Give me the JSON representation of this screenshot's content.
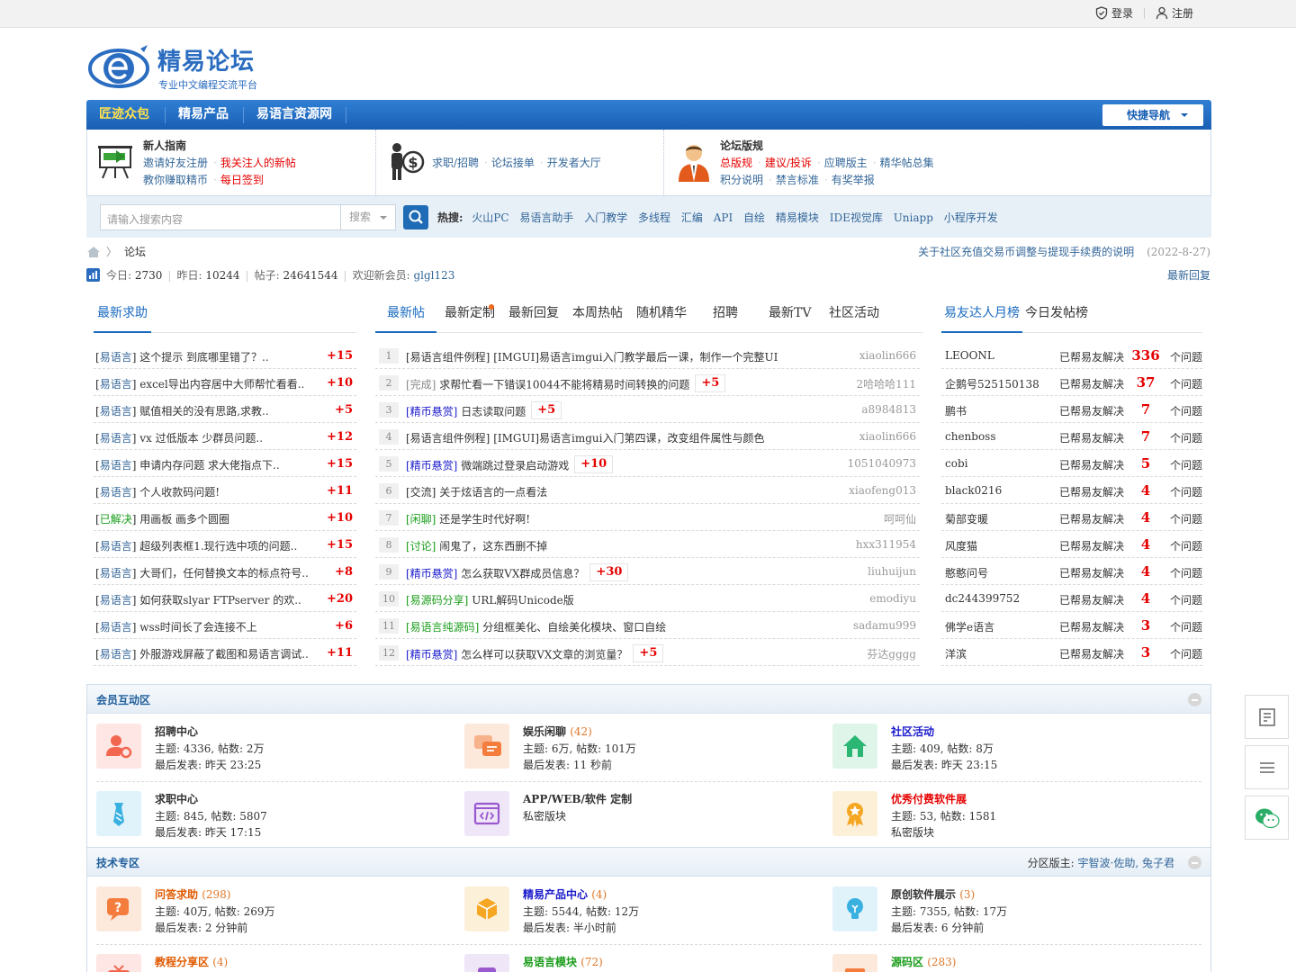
{
  "topbar": {
    "login": "登录",
    "register": "注册"
  },
  "logo": {
    "name": "精易论坛",
    "slogan": "专业中文编程交流平台"
  },
  "nav": {
    "items": [
      "匠迹众包",
      "精易产品",
      "易语言资源网"
    ],
    "quick": "快捷导航"
  },
  "guide": {
    "col1": {
      "title": "新人指南",
      "links1": [
        "邀请好友注册",
        "我关注人的新帖"
      ],
      "links2": [
        "教你赚取精币",
        "每日签到"
      ]
    },
    "col2": {
      "links": [
        "求职/招聘",
        "论坛接单",
        "开发者大厅"
      ]
    },
    "col3": {
      "title": "论坛版规",
      "links1": [
        "总版规",
        "建议/投诉",
        "应聘版主",
        "精华帖总集"
      ],
      "links2": [
        "积分说明",
        "禁言标准",
        "有奖举报"
      ]
    }
  },
  "search": {
    "placeholder": "请输入搜索内容",
    "type": "搜索",
    "hot_label": "热搜:",
    "hot": [
      "火山PC",
      "易语言助手",
      "入门教学",
      "多线程",
      "汇编",
      "API",
      "自绘",
      "精易模块",
      "IDE视觉库",
      "Uniapp",
      "小程序开发"
    ]
  },
  "breadcrumb": {
    "current": "论坛"
  },
  "notice": {
    "text": "关于社区充值交易币调整与提现手续费的说明",
    "date": "(2022-8-27)"
  },
  "stats": {
    "today_label": "今日:",
    "today": "2730",
    "yesterday_label": "昨日:",
    "yesterday": "10244",
    "posts_label": "帖子:",
    "posts": "24641544",
    "welcome_label": "欢迎新会员:",
    "new_member": "glgl123",
    "latest_reply": "最新回复"
  },
  "qa_tab": "最新求助",
  "qa_list": [
    {
      "cat": "易语言",
      "title": "这个提示 到底哪里错了？..",
      "pts": "+15"
    },
    {
      "cat": "易语言",
      "title": "excel导出内容居中大师帮忙看看..",
      "pts": "+10"
    },
    {
      "cat": "易语言",
      "title": "赋值相关的没有思路,求教..",
      "pts": "+5"
    },
    {
      "cat": "易语言",
      "title": "vx 过低版本 少群员问题..",
      "pts": "+12"
    },
    {
      "cat": "易语言",
      "title": "申请内存问题 求大佬指点下..",
      "pts": "+15"
    },
    {
      "cat": "易语言",
      "title": "个人收款码问题!",
      "pts": "+11"
    },
    {
      "cat": "已解决",
      "title": "用画板 画多个圆圈",
      "pts": "+10"
    },
    {
      "cat": "易语言",
      "title": "超级列表框1.现行选中项的问题..",
      "pts": "+15"
    },
    {
      "cat": "易语言",
      "title": "大哥们，任何替换文本的标点符号..",
      "pts": "+8"
    },
    {
      "cat": "易语言",
      "title": "如何获取slyar FTPserver 的欢..",
      "pts": "+20"
    },
    {
      "cat": "易语言",
      "title": "wss时间长了会连接不上",
      "pts": "+6"
    },
    {
      "cat": "易语言",
      "title": "外服游戏屏蔽了截图和易语言调试..",
      "pts": "+11"
    }
  ],
  "post_tabs": [
    "最新帖",
    "最新定制",
    "最新回复",
    "本周热帖",
    "随机精华",
    "招聘",
    "最新TV",
    "社区活动"
  ],
  "posts": [
    {
      "n": "1",
      "tag": "[易语言组件例程]",
      "title": "[IMGUI]易语言imgui入门教学最后一课，制作一个完整UI",
      "bonus": "",
      "user": "xiaolin666"
    },
    {
      "n": "2",
      "tag": "[完成]",
      "title": "求帮忙看一下错误10044不能将精易时间转换的问题",
      "bonus": "+5",
      "user": "2哈哈哈111"
    },
    {
      "n": "3",
      "tag": "[精币悬赏]",
      "title": "日志读取问题",
      "bonus": "+5",
      "user": "a8984813"
    },
    {
      "n": "4",
      "tag": "[易语言组件例程]",
      "title": "[IMGUI]易语言imgui入门第四课，改变组件属性与颜色",
      "bonus": "",
      "user": "xiaolin666"
    },
    {
      "n": "5",
      "tag": "[精币悬赏]",
      "title": "微端跳过登录启动游戏",
      "bonus": "+10",
      "user": "1051040973"
    },
    {
      "n": "6",
      "tag": "[交流]",
      "title": "关于炫语言的一点看法",
      "bonus": "",
      "user": "xiaofeng013"
    },
    {
      "n": "7",
      "tag": "[闲聊]",
      "title": "还是学生时代好啊!",
      "bonus": "",
      "user": "呵呵仙"
    },
    {
      "n": "8",
      "tag": "[讨论]",
      "title": "闹鬼了，这东西删不掉",
      "bonus": "",
      "user": "hxx311954"
    },
    {
      "n": "9",
      "tag": "[精币悬赏]",
      "title": "怎么获取VX群成员信息？",
      "bonus": "+30",
      "user": "liuhuijun"
    },
    {
      "n": "10",
      "tag": "[易源码分享]",
      "title": "URL解码Unicode版",
      "bonus": "",
      "user": "emodiyu"
    },
    {
      "n": "11",
      "tag": "[易语言纯源码]",
      "title": "分组框美化、自绘美化模块、窗口自绘",
      "bonus": "",
      "user": "sadamu999"
    },
    {
      "n": "12",
      "tag": "[精币悬赏]",
      "title": "怎么样可以获取VX文章的浏览量？",
      "bonus": "+5",
      "user": "芬达gggg"
    }
  ],
  "top_tabs": [
    "易友达人月榜",
    "今日发帖榜"
  ],
  "top_users": [
    {
      "name": "LEOONL",
      "help": "已帮易友解决",
      "count": "336",
      "unit": "个问题"
    },
    {
      "name": "企鹅号525150138",
      "help": "已帮易友解决",
      "count": "37",
      "unit": "个问题"
    },
    {
      "name": "鹏书",
      "help": "已帮易友解决",
      "count": "7",
      "unit": "个问题"
    },
    {
      "name": "chenboss",
      "help": "已帮易友解决",
      "count": "7",
      "unit": "个问题"
    },
    {
      "name": "cobi",
      "help": "已帮易友解决",
      "count": "5",
      "unit": "个问题"
    },
    {
      "name": "black0216",
      "help": "已帮易友解决",
      "count": "4",
      "unit": "个问题"
    },
    {
      "name": "菊部变暖",
      "help": "已帮易友解决",
      "count": "4",
      "unit": "个问题"
    },
    {
      "name": "风度猫",
      "help": "已帮易友解决",
      "count": "4",
      "unit": "个问题"
    },
    {
      "name": "憨憨问号",
      "help": "已帮易友解决",
      "count": "4",
      "unit": "个问题"
    },
    {
      "name": "dc244399752",
      "help": "已帮易友解决",
      "count": "4",
      "unit": "个问题"
    },
    {
      "name": "佛学e语言",
      "help": "已帮易友解决",
      "count": "3",
      "unit": "个问题"
    },
    {
      "name": "洋滨",
      "help": "已帮易友解决",
      "count": "3",
      "unit": "个问题"
    }
  ],
  "sections": {
    "member": {
      "title": "会员互动区",
      "forums": [
        {
          "name": "招聘中心",
          "count": "",
          "l2": "主题: 4336, 帖数: 2万",
          "l3": "最后发表: 昨天 23:25"
        },
        {
          "name": "娱乐闲聊",
          "count": "(42)",
          "l2": "主题: 6万, 帖数: 101万",
          "l3": "最后发表: 11 秒前"
        },
        {
          "name": "社区活动",
          "count": "",
          "l2": "主题: 409, 帖数: 8万",
          "l3": "最后发表: 昨天 23:15"
        },
        {
          "name": "求职中心",
          "count": "",
          "l2": "主题: 845, 帖数: 5807",
          "l3": "最后发表: 昨天 17:15"
        },
        {
          "name": "APP/WEB/软件 定制",
          "count": "",
          "l2": "私密版块",
          "l3": ""
        },
        {
          "name": "优秀付费软件展",
          "count": "",
          "l2": "主题: 53, 帖数: 1581",
          "l3": "私密版块"
        }
      ]
    },
    "tech": {
      "title": "技术专区",
      "mods_label": "分区版主:",
      "mods": "宇智波·佐助, 兔子君",
      "forums": [
        {
          "name": "问答求助",
          "count": "(298)",
          "l2": "主题: 40万, 帖数: 269万",
          "l3": "最后发表: 2 分钟前"
        },
        {
          "name": "精易产品中心",
          "count": "(4)",
          "l2": "主题: 5544, 帖数: 12万",
          "l3": "最后发表: 半小时前"
        },
        {
          "name": "原创软件展示",
          "count": "(3)",
          "l2": "主题: 7355, 帖数: 17万",
          "l3": "最后发表: 6 分钟前"
        },
        {
          "name": "教程分享区",
          "count": "(4)",
          "l2": "",
          "l3": ""
        },
        {
          "name": "易语言模块",
          "count": "(72)",
          "l2": "",
          "l3": ""
        },
        {
          "name": "源码区",
          "count": "(283)",
          "l2": "",
          "l3": ""
        }
      ]
    }
  },
  "colors": {
    "brand": "#1a5fb4",
    "link": "#336699",
    "accent_red": "#e60000",
    "nav_active": "#ffe14d"
  }
}
